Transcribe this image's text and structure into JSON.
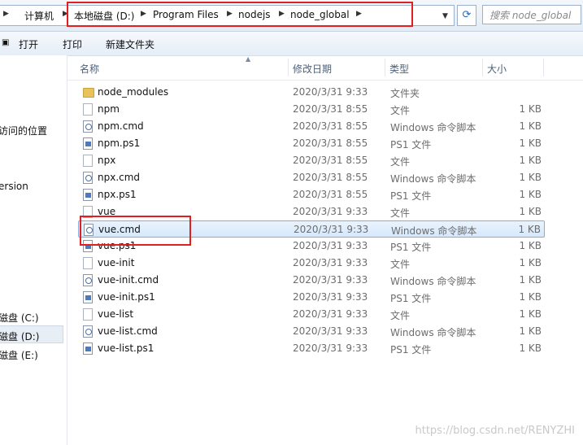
{
  "address": {
    "crumbs": [
      "计算机",
      "本地磁盘 (D:)",
      "Program Files",
      "nodejs",
      "node_global"
    ],
    "search_placeholder": "搜索 node_global"
  },
  "toolbar": {
    "open_label": "打开",
    "print_label": "打印",
    "new_folder_label": "新建文件夹"
  },
  "nav": {
    "items": [
      "访问的位置",
      "ersion",
      "磁盘 (C:)",
      "磁盘 (D:)",
      "磁盘 (E:)"
    ]
  },
  "columns": {
    "name": "名称",
    "date": "修改日期",
    "type": "类型",
    "size": "大小"
  },
  "files": [
    {
      "name": "node_modules",
      "date": "2020/3/31 9:33",
      "type": "文件夹",
      "size": "",
      "icon": "folder-icon"
    },
    {
      "name": "npm",
      "date": "2020/3/31 8:55",
      "type": "文件",
      "size": "1 KB",
      "icon": "file-icon"
    },
    {
      "name": "npm.cmd",
      "date": "2020/3/31 8:55",
      "type": "Windows 命令脚本",
      "size": "1 KB",
      "icon": "cmd-file-icon"
    },
    {
      "name": "npm.ps1",
      "date": "2020/3/31 8:55",
      "type": "PS1 文件",
      "size": "1 KB",
      "icon": "ps1-file-icon"
    },
    {
      "name": "npx",
      "date": "2020/3/31 8:55",
      "type": "文件",
      "size": "1 KB",
      "icon": "file-icon"
    },
    {
      "name": "npx.cmd",
      "date": "2020/3/31 8:55",
      "type": "Windows 命令脚本",
      "size": "1 KB",
      "icon": "cmd-file-icon"
    },
    {
      "name": "npx.ps1",
      "date": "2020/3/31 8:55",
      "type": "PS1 文件",
      "size": "1 KB",
      "icon": "ps1-file-icon"
    },
    {
      "name": "vue",
      "date": "2020/3/31 9:33",
      "type": "文件",
      "size": "1 KB",
      "icon": "file-icon"
    },
    {
      "name": "vue.cmd",
      "date": "2020/3/31 9:33",
      "type": "Windows 命令脚本",
      "size": "1 KB",
      "icon": "cmd-file-icon",
      "selected": true
    },
    {
      "name": "vue.ps1",
      "date": "2020/3/31 9:33",
      "type": "PS1 文件",
      "size": "1 KB",
      "icon": "ps1-file-icon"
    },
    {
      "name": "vue-init",
      "date": "2020/3/31 9:33",
      "type": "文件",
      "size": "1 KB",
      "icon": "file-icon"
    },
    {
      "name": "vue-init.cmd",
      "date": "2020/3/31 9:33",
      "type": "Windows 命令脚本",
      "size": "1 KB",
      "icon": "cmd-file-icon"
    },
    {
      "name": "vue-init.ps1",
      "date": "2020/3/31 9:33",
      "type": "PS1 文件",
      "size": "1 KB",
      "icon": "ps1-file-icon"
    },
    {
      "name": "vue-list",
      "date": "2020/3/31 9:33",
      "type": "文件",
      "size": "1 KB",
      "icon": "file-icon"
    },
    {
      "name": "vue-list.cmd",
      "date": "2020/3/31 9:33",
      "type": "Windows 命令脚本",
      "size": "1 KB",
      "icon": "cmd-file-icon"
    },
    {
      "name": "vue-list.ps1",
      "date": "2020/3/31 9:33",
      "type": "PS1 文件",
      "size": "1 KB",
      "icon": "ps1-file-icon"
    }
  ],
  "watermark": "https://blog.csdn.net/RENYZHI",
  "colors": {
    "annotation_red": "#e02020",
    "selection_border": "#84acdd"
  }
}
